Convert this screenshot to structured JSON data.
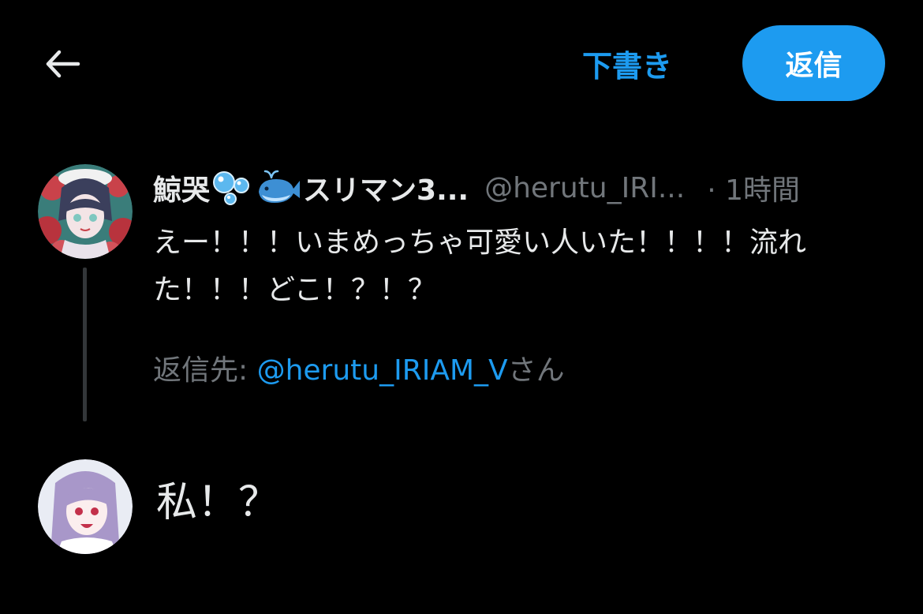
{
  "topbar": {
    "back_icon": "arrow-left-icon",
    "drafts_label": "下書き",
    "reply_label": "返信",
    "accent_color": "#1d9bf0"
  },
  "parent_tweet": {
    "display_name": "鯨哭",
    "display_name_suffix": "スリマン3...",
    "emojis": [
      "bubbles-emoji",
      "whale-emoji"
    ],
    "handle": "@herutu_IRI...",
    "time": "· 1時間",
    "text": "えー！！！いまめっちゃ可愛い人いた！！！！流れた！！！どこ！？！？",
    "replying_to_prefix": "返信先: ",
    "replying_to_handle": "@herutu_IRIAM_V",
    "replying_to_suffix": "さん"
  },
  "compose": {
    "text": "私！？"
  }
}
